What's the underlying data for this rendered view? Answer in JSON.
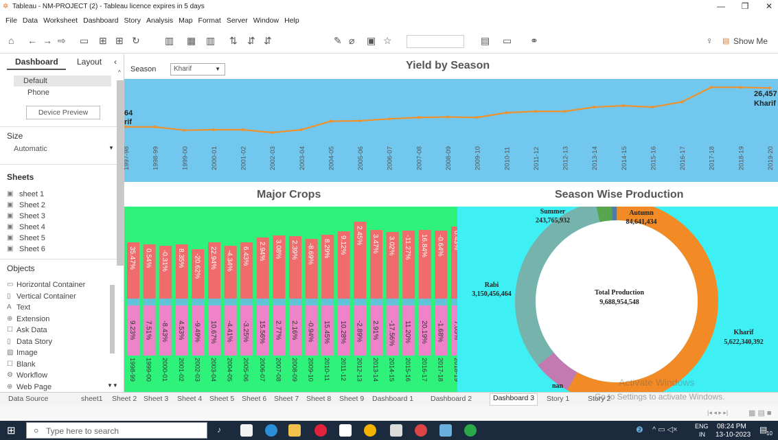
{
  "window": {
    "title": "Tableau - NM-PROJECT (2) - Tableau licence expires in 5 days"
  },
  "menu": [
    "File",
    "Data",
    "Worksheet",
    "Dashboard",
    "Story",
    "Analysis",
    "Map",
    "Format",
    "Server",
    "Window",
    "Help"
  ],
  "toolbar": {
    "show_me": "Show Me"
  },
  "left_panel": {
    "tabs": [
      "Dashboard",
      "Layout"
    ],
    "devices": [
      "Default",
      "Phone"
    ],
    "device_preview": "Device Preview",
    "size_label": "Size",
    "size_value": "Automatic",
    "sheets_label": "Sheets",
    "sheets": [
      "sheet 1",
      "Sheet 2",
      "Sheet 3",
      "Sheet 4",
      "Sheet 5",
      "Sheet 6"
    ],
    "objects_label": "Objects",
    "objects": [
      "Horizontal Container",
      "Vertical Container",
      "Text",
      "Extension",
      "Ask Data",
      "Data Story",
      "Image",
      "Blank",
      "Workflow",
      "Web Page"
    ]
  },
  "filter": {
    "label": "Season",
    "value": "Kharif"
  },
  "yield_chart": {
    "title": "Yield by Season",
    "left_label_value": "64",
    "left_label_season": "rif",
    "end_label_value": "26,457",
    "end_label_season": "Kharif"
  },
  "chart_data": [
    {
      "type": "line",
      "title": "Yield by Season",
      "x": [
        "1997-98",
        "1998-99",
        "1999-00",
        "2000-01",
        "2001-02",
        "2002-03",
        "2003-04",
        "2004-05",
        "2005-06",
        "2006-07",
        "2007-08",
        "2008-09",
        "2009-10",
        "2010-11",
        "2011-12",
        "2012-13",
        "2013-14",
        "2014-15",
        "2015-16",
        "2016-17",
        "2017-18",
        "2018-19",
        "2019-20"
      ],
      "series": [
        {
          "values": [
            18200,
            18200,
            17500,
            17600,
            17600,
            17000,
            17600,
            19400,
            19500,
            19900,
            20200,
            20300,
            20200,
            21200,
            21500,
            21500,
            22400,
            22700,
            22400,
            23500,
            26600,
            26600,
            26457
          ]
        }
      ],
      "color": "#f0922b"
    },
    {
      "type": "bar",
      "title": "Major Crops",
      "categories": [
        "1998-99",
        "1999-00",
        "2000-01",
        "2001-02",
        "2002-03",
        "2003-04",
        "2004-05",
        "2005-06",
        "2006-07",
        "2007-08",
        "2008-09",
        "2009-10",
        "2010-11",
        "2011-12",
        "2012-13",
        "2013-14",
        "2014-15",
        "2015-16",
        "2016-17",
        "2017-18",
        "2018-19"
      ],
      "top_labels": [
        "35.47%",
        "0.54%",
        "-0.31%",
        "8.35%",
        "-20.62%",
        "22.94%",
        "-4.34%",
        "6.43%",
        "2.94%",
        "3.08%",
        "2.39%",
        "-8.69%",
        "8.29%",
        "9.12%",
        "2.45%",
        "3.47%",
        "3.02%",
        "-11.27%",
        "16.84%",
        "-0.64%",
        "0.43%"
      ],
      "bottom_labels": [
        "9.23%",
        "7.51%",
        "-8.43%",
        "4.53%",
        "-9.49%",
        "10.67%",
        "-4.41%",
        "-3.25%",
        "15.56%",
        "2.77%",
        "2.16%",
        "-0.94%",
        "15.45%",
        "10.28%",
        "-2.89%",
        "2.91%",
        "-17.56%",
        "11.20%",
        "20.19%",
        "-1.68%",
        "7.05%"
      ],
      "heights": [
        165,
        162,
        160,
        162,
        155,
        165,
        160,
        165,
        172,
        175,
        174,
        170,
        176,
        181,
        195,
        183,
        180,
        182,
        183,
        182,
        188
      ],
      "colors": {
        "background": "#2ef27a",
        "top": "#f06b6b",
        "mid": "#62c3d6",
        "bottom": "#ef83c9"
      }
    },
    {
      "type": "pie",
      "title": "Season Wise Production",
      "slices": [
        {
          "name": "Kharif",
          "value": 5622340392,
          "label": "5,622,340,392",
          "color": "#f28b25"
        },
        {
          "name": "Rabi",
          "value": 3150456464,
          "label": "3,150,456,464",
          "color": "#76b3ad"
        },
        {
          "name": "Summer",
          "value": 243765932,
          "label": "243,765,932",
          "color": "#58a550"
        },
        {
          "name": "Autumn",
          "value": 84641434,
          "label": "84,641,434",
          "color": "#5279ab"
        },
        {
          "name": "nan",
          "value": 587750326,
          "label": "",
          "color": "#c17bb0"
        }
      ],
      "center_title": "Total Production",
      "center_value": "9,688,954,548"
    }
  ],
  "watermark": "Go to Settings to activate Windows.",
  "watermark_head": "Activate Windows",
  "bottom_tabs": [
    "Data Source",
    "sheet1",
    "Sheet 2",
    "Sheet 3",
    "Sheet 4",
    "Sheet 5",
    "Sheet 6",
    "Sheet 7",
    "Sheet 8",
    "Sheet 9",
    "Dashboard 1",
    "Dashboard 2",
    "Dashboard 3",
    "Story 1",
    "Story 2"
  ],
  "taskbar": {
    "search_placeholder": "Type here to search",
    "lang": "ENG",
    "region": "IN",
    "time": "08:24 PM",
    "date": "13-10-2023",
    "notif": "10"
  }
}
